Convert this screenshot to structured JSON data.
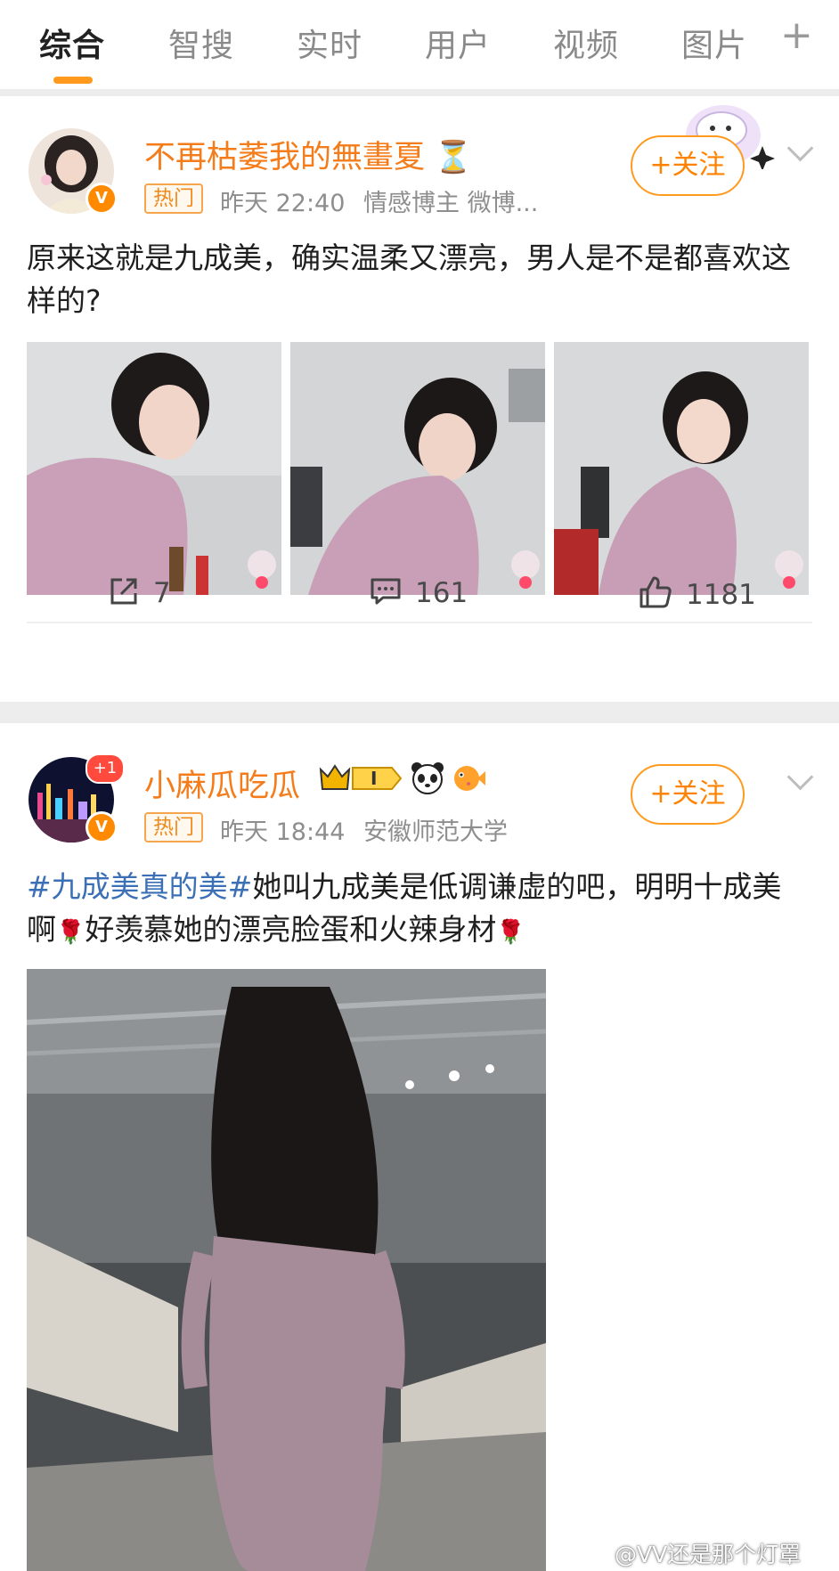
{
  "tabs": [
    {
      "label": "综合",
      "active": true
    },
    {
      "label": "智搜"
    },
    {
      "label": "实时"
    },
    {
      "label": "用户"
    },
    {
      "label": "视频"
    },
    {
      "label": "图片"
    }
  ],
  "tab_add_icon": "plus-icon",
  "accent_color": "#ff8200",
  "posts": [
    {
      "author": "不再枯萎我的無畫夏",
      "author_emoji": "⏳",
      "hot_label": "热门",
      "time": "昨天 22:40",
      "source": "情感博主 微博...",
      "follow_label": "+关注",
      "text": "原来这就是九成美，确实温柔又漂亮，男人是不是都喜欢这样的?",
      "images": 3,
      "actions": {
        "repost": "7",
        "comment": "161",
        "like": "1181"
      }
    },
    {
      "author": "小麻瓜吃瓜",
      "author_badge": "I",
      "plus_badge": "+1",
      "hot_label": "热门",
      "time": "昨天 18:44",
      "source": "安徽师范大学",
      "follow_label": "+关注",
      "topic": "#九成美真的美#",
      "text_part1": "她叫九成美是低调谦虚的吧，明明十成美啊",
      "text_part2": "好羡慕她的漂亮脸蛋和火辣身材",
      "images": 1
    }
  ],
  "watermark": "@VV还是那个灯罩"
}
